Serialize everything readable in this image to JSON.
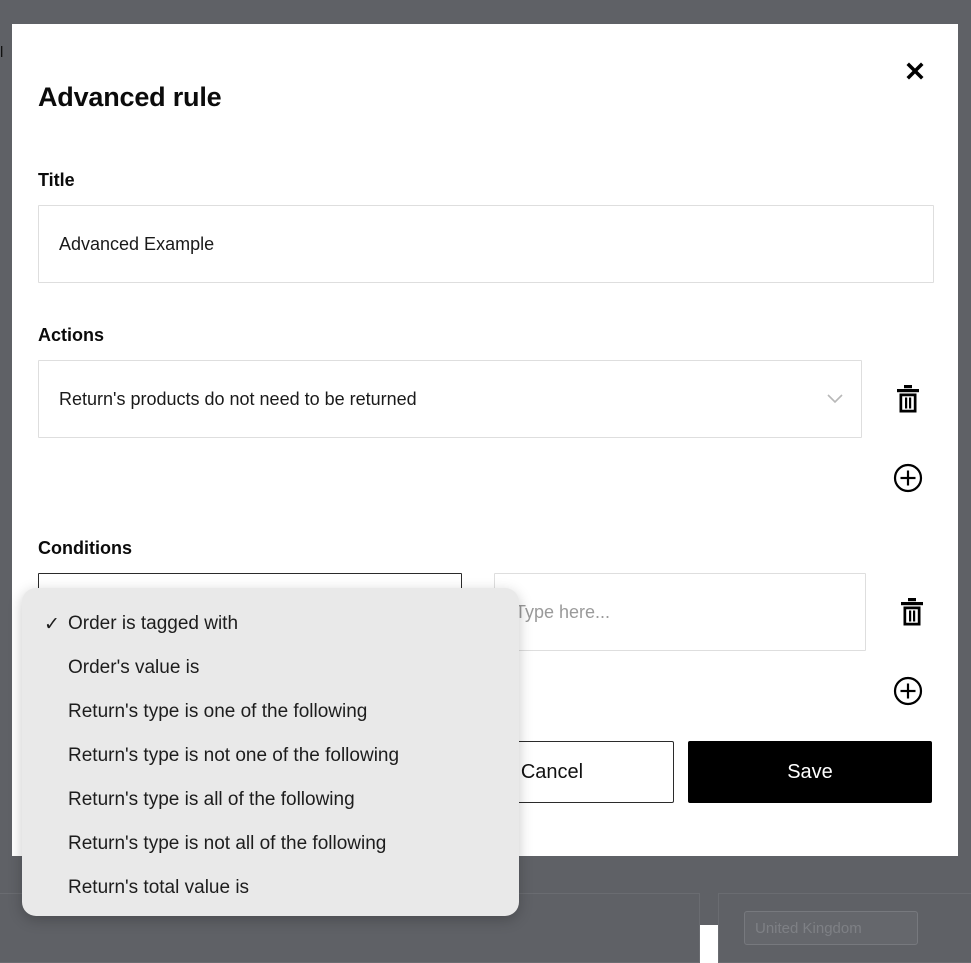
{
  "modal": {
    "title": "Advanced rule",
    "close_icon": "close-icon",
    "title_section": {
      "label": "Title",
      "value": "Advanced Example",
      "placeholder": ""
    },
    "actions_section": {
      "label": "Actions",
      "selected_action": "Return's products do not need to be returned",
      "chevron_icon": "chevron-down-icon",
      "delete_icon": "trash-icon",
      "add_icon": "plus-circle-icon"
    },
    "conditions_section": {
      "label": "Conditions",
      "selected_condition": "Order is tagged with",
      "value_placeholder": "Type here...",
      "value": "",
      "delete_icon": "trash-icon",
      "add_icon": "plus-circle-icon"
    },
    "footer": {
      "cancel_label": "Cancel",
      "save_label": "Save"
    }
  },
  "dropdown": {
    "check_glyph": "✓",
    "selected_index": 0,
    "options": [
      "Order is tagged with",
      "Order's value is",
      "Return's type is one of the following",
      "Return's type is not one of the following",
      "Return's type is all of the following",
      "Return's type is not all of the following",
      "Return's total value is"
    ]
  },
  "background": {
    "fragment_text": "l",
    "pill_text": "United Kingdom"
  },
  "colors": {
    "overlay": "#5f6166",
    "modal_bg": "#ffffff",
    "accent_dark": "#000000",
    "menu_bg": "#e9e9e9",
    "border_light": "#dedede",
    "border_focus": "#2b2b2b"
  }
}
